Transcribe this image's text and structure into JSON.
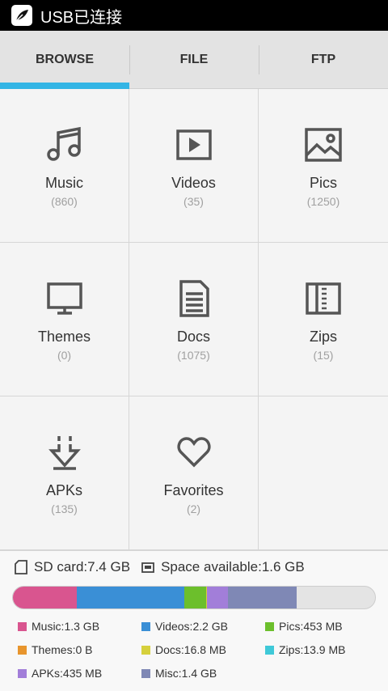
{
  "statusbar": {
    "text": "USB已连接"
  },
  "tabs": [
    {
      "label": "BROWSE",
      "active": true
    },
    {
      "label": "FILE",
      "active": false
    },
    {
      "label": "FTP",
      "active": false
    }
  ],
  "categories": [
    {
      "label": "Music",
      "count": "(860)",
      "icon": "music-note-icon"
    },
    {
      "label": "Videos",
      "count": "(35)",
      "icon": "video-play-icon"
    },
    {
      "label": "Pics",
      "count": "(1250)",
      "icon": "picture-icon"
    },
    {
      "label": "Themes",
      "count": "(0)",
      "icon": "monitor-icon"
    },
    {
      "label": "Docs",
      "count": "(1075)",
      "icon": "document-icon"
    },
    {
      "label": "Zips",
      "count": "(15)",
      "icon": "zip-archive-icon"
    },
    {
      "label": "APKs",
      "count": "(135)",
      "icon": "apk-download-icon"
    },
    {
      "label": "Favorites",
      "count": "(2)",
      "icon": "heart-icon"
    }
  ],
  "storage": {
    "sd_card": "SD card:7.4 GB",
    "space_available": "Space available:1.6 GB",
    "bar_total_gb": 7.4,
    "segments": [
      {
        "name": "Music",
        "gb": 1.3,
        "color": "#d9558f"
      },
      {
        "name": "Videos",
        "gb": 2.2,
        "color": "#3a8fd6"
      },
      {
        "name": "Pics",
        "gb": 0.443,
        "color": "#6cbf2c"
      },
      {
        "name": "Themes",
        "gb": 0,
        "color": "#e8952d"
      },
      {
        "name": "Docs",
        "gb": 0.0164,
        "color": "#d6d03c"
      },
      {
        "name": "Zips",
        "gb": 0.0136,
        "color": "#3fc9d8"
      },
      {
        "name": "APKs",
        "gb": 0.425,
        "color": "#a27ed9"
      },
      {
        "name": "Misc",
        "gb": 1.4,
        "color": "#7f88b5"
      }
    ],
    "legend": [
      {
        "text": "Music:1.3 GB",
        "color": "#d9558f"
      },
      {
        "text": "Videos:2.2 GB",
        "color": "#3a8fd6"
      },
      {
        "text": "Pics:453 MB",
        "color": "#6cbf2c"
      },
      {
        "text": "Themes:0 B",
        "color": "#e8952d"
      },
      {
        "text": "Docs:16.8 MB",
        "color": "#d6d03c"
      },
      {
        "text": "Zips:13.9 MB",
        "color": "#3fc9d8"
      },
      {
        "text": "APKs:435 MB",
        "color": "#a27ed9"
      },
      {
        "text": "Misc:1.4 GB",
        "color": "#7f88b5"
      }
    ]
  }
}
